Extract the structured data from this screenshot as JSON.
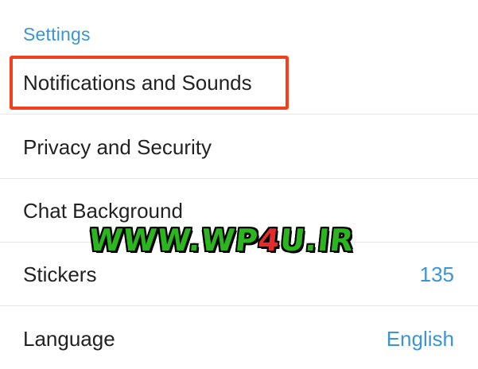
{
  "section": {
    "title": "Settings"
  },
  "rows": [
    {
      "label": "Notifications and Sounds",
      "value": ""
    },
    {
      "label": "Privacy and Security",
      "value": ""
    },
    {
      "label": "Chat Background",
      "value": ""
    },
    {
      "label": "Stickers",
      "value": "135"
    },
    {
      "label": "Language",
      "value": "English"
    }
  ],
  "watermark": {
    "part1": "WWW.WP",
    "part2": "4",
    "part3": "U.IR"
  },
  "colors": {
    "accent": "#3a95d1",
    "highlight": "#f4401a",
    "watermark_green": "#2bb51f",
    "watermark_red": "#e32d2d"
  }
}
